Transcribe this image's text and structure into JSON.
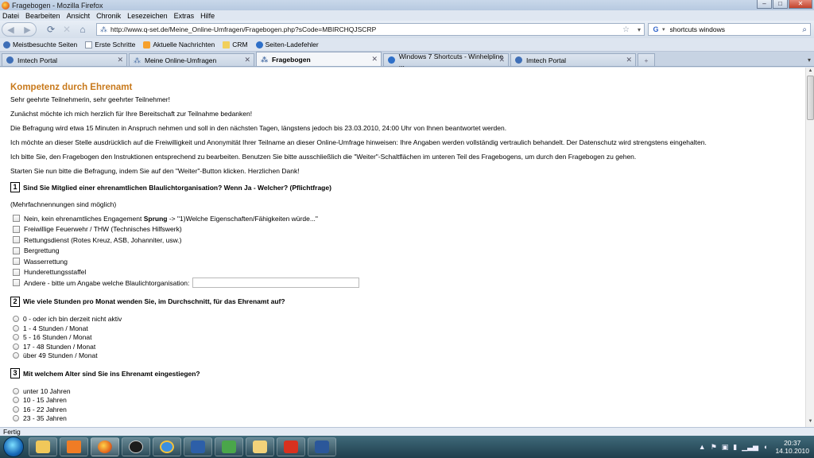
{
  "window": {
    "title": "Fragebogen - Mozilla Firefox"
  },
  "menu": [
    "Datei",
    "Bearbeiten",
    "Ansicht",
    "Chronik",
    "Lesezeichen",
    "Extras",
    "Hilfe"
  ],
  "nav": {
    "url": "http://www.q-set.de/Meine_Online-Umfragen/Fragebogen.php?sCode=MBIRCHQJSCRP",
    "search_value": "shortcuts windows"
  },
  "bookmarks": [
    {
      "label": "Meistbesuchte Seiten",
      "icon": "gear-icon"
    },
    {
      "label": "Erste Schritte",
      "icon": "page-icon"
    },
    {
      "label": "Aktuelle Nachrichten",
      "icon": "rss-icon"
    },
    {
      "label": "CRM",
      "icon": "folder-icon"
    },
    {
      "label": "Seiten-Ladefehler",
      "icon": "globe-icon"
    }
  ],
  "tabs": [
    {
      "label": "Imtech Portal",
      "active": false
    },
    {
      "label": "Meine Online-Umfragen",
      "active": false
    },
    {
      "label": "Fragebogen",
      "active": true
    },
    {
      "label": "Windows 7 Shortcuts - Winhelpline ...",
      "active": false
    },
    {
      "label": "Imtech Portal",
      "active": false
    }
  ],
  "page": {
    "heading": "Kompetenz durch Ehrenamt",
    "intro": [
      "Sehr geehrte Teilnehmerin, sehr geehrter Teilnehmer!",
      "Zunächst möchte ich mich herzlich für Ihre Bereitschaft zur Teilnahme bedanken!",
      "Die Befragung wird etwa 15 Minuten in Anspruch nehmen und soll in den nächsten Tagen, längstens jedoch bis 23.03.2010, 24:00 Uhr von Ihnen beantwortet werden.",
      "Ich möchte an dieser Stelle ausdrücklich auf die Freiwilligkeit und Anonymität Ihrer Teilname an dieser Online-Umfrage hinweisen: Ihre Angaben werden vollständig vertraulich behandelt. Der Datenschutz wird strengstens eingehalten.",
      "Ich bitte Sie, den Fragebogen den Instruktionen entsprechend zu bearbeiten. Benutzen Sie bitte ausschließlich die \"Weiter\"-Schaltflächen im unteren Teil des Fragebogens, um durch den Fragebogen zu gehen.",
      "Starten Sie nun bitte die Befragung, indem Sie auf den \"Weiter\"-Button klicken. Herzlichen Dank!"
    ],
    "q1": {
      "number": "1",
      "text": "Sind Sie Mitglied einer ehrenamtlichen Blaulichtorganisation? Wenn Ja - Welcher? (Pflichtfrage)",
      "hint": "(Mehrfachnennungen sind möglich)",
      "opt0_pre": "Nein, kein ehrenamtliches Engagement ",
      "opt0_bold": "Sprung",
      "opt0_post": " -> \"1)Welche Eigenschaften/Fähigkeiten würde...\"",
      "options": [
        "Freiwillige Feuerwehr / THW (Technisches Hilfswerk)",
        "Rettungsdienst (Rotes Kreuz, ASB, Johanniter, usw.)",
        "Bergrettung",
        "Wasserrettung",
        "Hunderettungsstaffel"
      ],
      "other_label": "Andere - bitte um Angabe welche Blaulichtorganisation:"
    },
    "q2": {
      "number": "2",
      "text": "Wie viele Stunden pro Monat wenden Sie, im Durchschnitt, für das Ehrenamt auf?",
      "options": [
        "0 - oder ich bin derzeit nicht aktiv",
        "1 - 4 Stunden / Monat",
        "5 - 16 Stunden / Monat",
        "17 - 48 Stunden / Monat",
        "über 49 Stunden / Monat"
      ]
    },
    "q3": {
      "number": "3",
      "text": "Mit welchem Alter sind Sie ins Ehrenamt eingestiegen?",
      "options": [
        "unter 10 Jahren",
        "10 - 15 Jahren",
        "16 - 22 Jahren",
        "23 - 35 Jahren"
      ]
    }
  },
  "status": "Fertig",
  "clock": {
    "time": "20:37",
    "date": "14.10.2010"
  }
}
